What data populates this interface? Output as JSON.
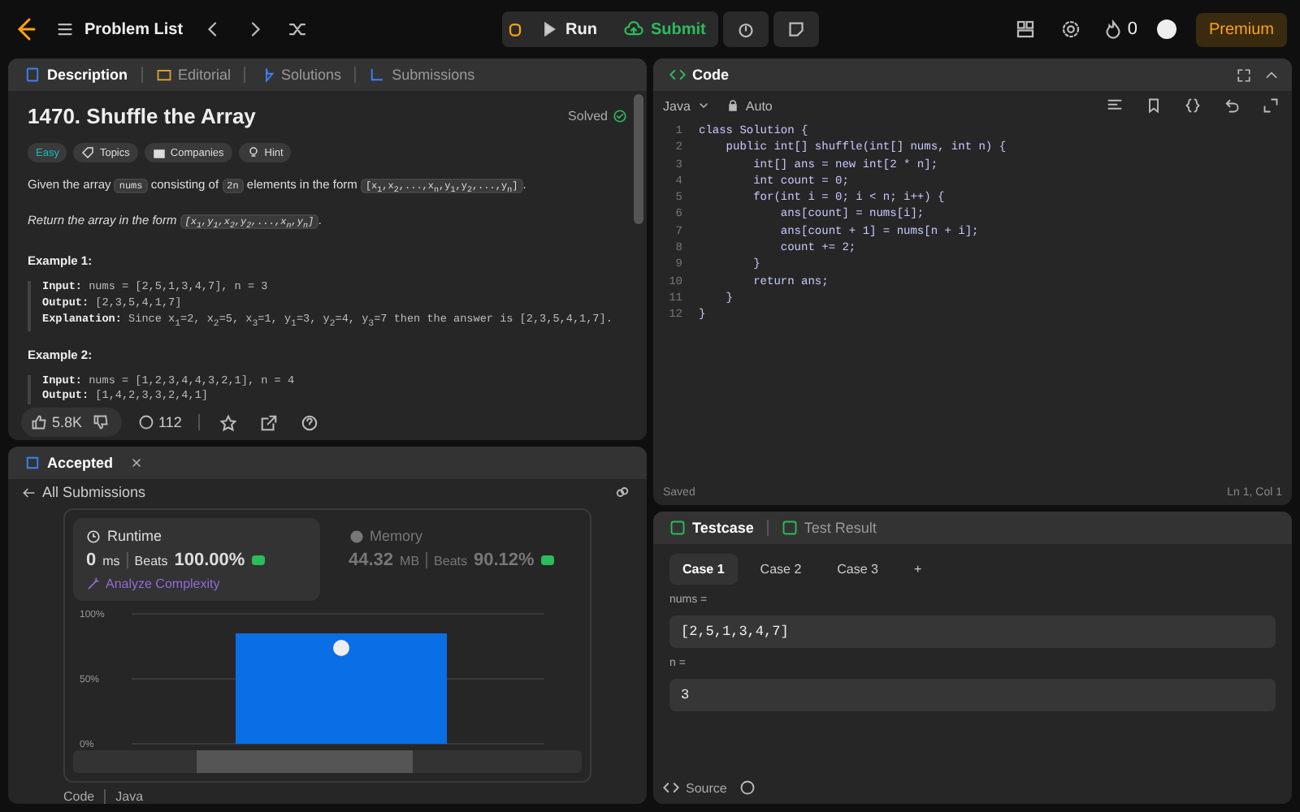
{
  "top_bar": {
    "problem_list": "Problem List",
    "run": "Run",
    "submit": "Submit",
    "streak": "0",
    "premium": "Premium"
  },
  "description_panel": {
    "tabs": [
      {
        "label": "Description",
        "selected": true
      },
      {
        "label": "Editorial",
        "selected": false
      },
      {
        "label": "Solutions",
        "selected": false
      },
      {
        "label": "Submissions",
        "selected": false
      }
    ],
    "title": "1470. Shuffle the Array",
    "status": "Solved",
    "tags": [
      {
        "label": "Easy",
        "kind": "difficulty"
      },
      {
        "label": "Topics",
        "kind": "topics"
      },
      {
        "label": "Companies",
        "kind": "companies"
      },
      {
        "label": "Hint",
        "kind": "hint"
      }
    ],
    "paragraphs": [
      {
        "italic": false,
        "segments": [
          {
            "kind": "text",
            "text": "Given the array "
          },
          {
            "kind": "code",
            "text": "nums"
          },
          {
            "kind": "text",
            "text": " consisting of "
          },
          {
            "kind": "code",
            "text": "2n"
          },
          {
            "kind": "text",
            "text": " elements in the form "
          },
          {
            "kind": "code",
            "text": "[x$_{1}$,x$_{2}$,...,x$_{n}$,y$_{1}$,y$_{2}$,...,y$_{n}$]"
          },
          {
            "kind": "text",
            "text": "."
          }
        ]
      },
      {
        "italic": true,
        "segments": [
          {
            "kind": "text",
            "text": "Return the array in the form "
          },
          {
            "kind": "code",
            "text": "[x$_{1}$,y$_{1}$,x$_{2}$,y$_{2}$,...,x$_{n}$,y$_{n}$]"
          },
          {
            "kind": "text",
            "text": "."
          }
        ]
      }
    ],
    "examples": [
      {
        "title": "Example 1:",
        "lines": [
          {
            "label": "Input:",
            "value": "nums = [2,5,1,3,4,7], n = 3"
          },
          {
            "label": "Output:",
            "value": "[2,3,5,4,1,7]"
          },
          {
            "label": "Explanation:",
            "value": "Since x$_{1}$=2, x$_{2}$=5, x$_{3}$=1, y$_{1}$=3, y$_{2}$=4, y$_{3}$=7 then the answer is [2,3,5,4,1,7]."
          }
        ]
      },
      {
        "title": "Example 2:",
        "lines": [
          {
            "label": "Input:",
            "value": "nums = [1,2,3,4,4,3,2,1], n = 4"
          },
          {
            "label": "Output:",
            "value": "[1,4,2,3,3,2,4,1]"
          }
        ]
      }
    ],
    "likes": "5.8K",
    "comments": "112"
  },
  "result_panel": {
    "tab": "Accepted",
    "back_link": "All Submissions",
    "stats": [
      {
        "kind": "runtime",
        "title": "Runtime",
        "selected": true,
        "value": "0",
        "unit": "ms",
        "beats_label": "Beats",
        "beats": "100.00%",
        "link": "Analyze Complexity"
      },
      {
        "kind": "memory",
        "title": "Memory",
        "selected": false,
        "value": "44.32",
        "unit": "MB",
        "beats_label": "Beats",
        "beats": "90.12%"
      }
    ],
    "chart_data": {
      "type": "bar",
      "values": [
        85
      ],
      "ylim": [
        0,
        100
      ],
      "yticks": [
        {
          "value": 0,
          "label": "0%"
        },
        {
          "value": 50,
          "label": "50%"
        },
        {
          "value": 100,
          "label": "100%"
        }
      ]
    },
    "code_label": "Code",
    "language": "Java"
  },
  "code_panel": {
    "tab": "Code",
    "language": "Java",
    "mode": "Auto",
    "lines": [
      {
        "number": "1",
        "text": "class Solution {"
      },
      {
        "number": "2",
        "text": "    public int[] shuffle(int[] nums, int n) {"
      },
      {
        "number": "3",
        "text": "        int[] ans = new int[2 * n];"
      },
      {
        "number": "4",
        "text": "        int count = 0;"
      },
      {
        "number": "5",
        "text": "        for(int i = 0; i < n; i++) {"
      },
      {
        "number": "6",
        "text": "            ans[count] = nums[i];"
      },
      {
        "number": "7",
        "text": "            ans[count + 1] = nums[n + i];"
      },
      {
        "number": "8",
        "text": "            count += 2;"
      },
      {
        "number": "9",
        "text": "        }"
      },
      {
        "number": "10",
        "text": "        return ans;"
      },
      {
        "number": "11",
        "text": "    }"
      },
      {
        "number": "12",
        "text": "}"
      }
    ],
    "status": "Saved",
    "cursor": "Ln 1, Col 1"
  },
  "testcase_panel": {
    "tabs": [
      {
        "label": "Testcase",
        "selected": true
      },
      {
        "label": "Test Result",
        "selected": false
      }
    ],
    "cases": [
      {
        "label": "Case 1",
        "selected": true
      },
      {
        "label": "Case 2",
        "selected": false
      },
      {
        "label": "Case 3",
        "selected": false
      }
    ],
    "add": "+",
    "inputs": [
      {
        "label": "nums =",
        "value": "[2,5,1,3,4,7]"
      },
      {
        "label": "n =",
        "value": "3"
      }
    ],
    "source": "Source"
  }
}
